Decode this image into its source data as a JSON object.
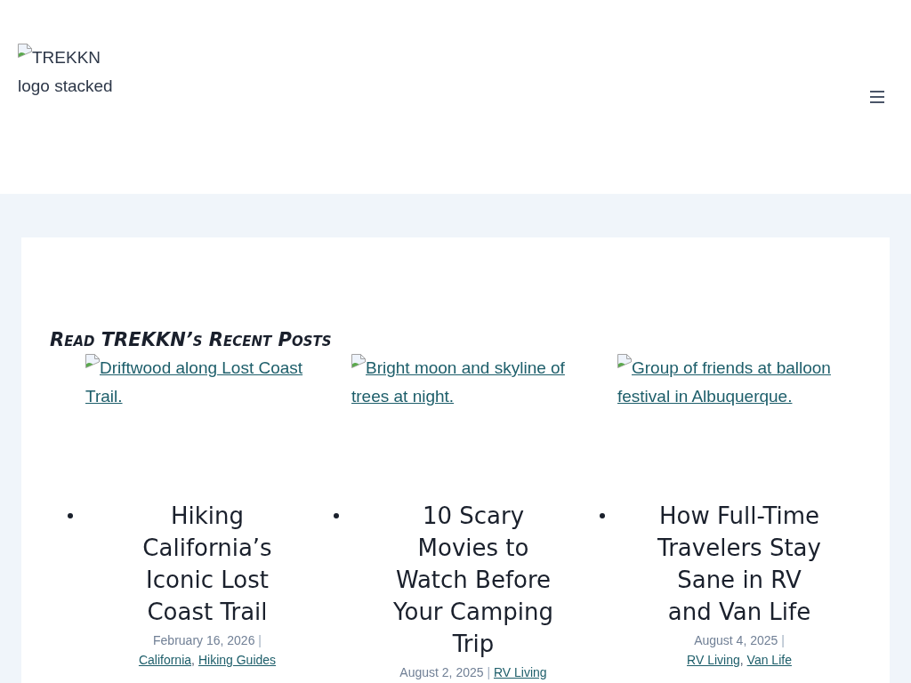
{
  "header": {
    "logo_alt": "TREKKN logo stacked"
  },
  "section": {
    "heading": "Read TREKKN’s Recent Posts"
  },
  "posts": [
    {
      "image_alt": "Driftwood along Lost Coast Trail.",
      "title": "Hiking California’s Iconic Lost Coast Trail",
      "date": "February 16, 2026",
      "date_separator": "|",
      "categories": [
        {
          "label": "California",
          "separator": ","
        },
        {
          "label": "Hiking Guides"
        }
      ]
    },
    {
      "image_alt": "Bright moon and skyline of trees at night.",
      "title": "10 Scary Movies to Watch Before Your Camping Trip",
      "date": "August 2, 2025",
      "date_separator": "|",
      "categories": [
        {
          "label": "RV Living"
        }
      ]
    },
    {
      "image_alt": "Group of friends at balloon festival in Albuquerque.",
      "title": "How Full-Time Travelers Stay Sane in RV and Van Life",
      "date": "August 4, 2025",
      "date_separator": "|",
      "categories": [
        {
          "label": "RV Living",
          "separator": ","
        },
        {
          "label": "Van Life"
        }
      ]
    }
  ]
}
